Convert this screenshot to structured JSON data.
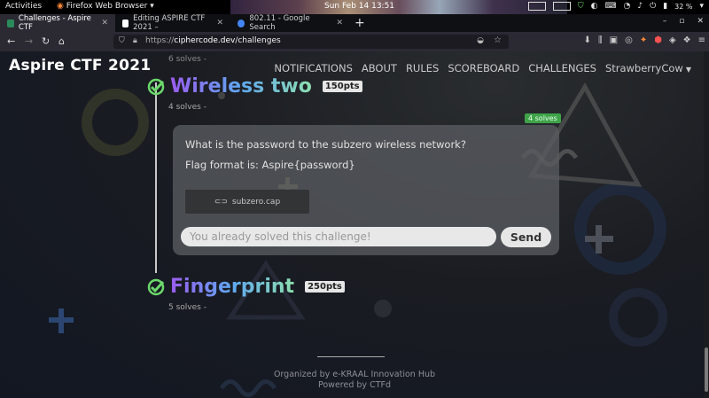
{
  "gnome": {
    "activities": "Activities",
    "app_name": "Firefox Web Browser",
    "clock": "Sun Feb 14  13:51",
    "battery": "32 %"
  },
  "tabs": [
    {
      "title": "Challenges - Aspire CTF",
      "favicon_color": "#2a8a5a"
    },
    {
      "title": "Editing ASPIRE CTF 2021 –",
      "favicon_color": "#ffffff"
    },
    {
      "title": "802.11 - Google Search",
      "favicon_color": "#4285f4"
    }
  ],
  "navbar": {
    "url_prefix": "https://",
    "url_host": "ciphercode.dev",
    "url_path": "/challenges"
  },
  "site": {
    "brand": "Aspire CTF 2021",
    "nav": [
      "NOTIFICATIONS",
      "ABOUT",
      "RULES",
      "SCOREBOARD",
      "CHALLENGES",
      "StrawberryCow"
    ],
    "prev_solves": "6 solves -"
  },
  "challenges": [
    {
      "name": "Wireless two",
      "points": "150pts",
      "solves": "4 solves -",
      "badge": "4 solves",
      "description": "What is the password to the subzero wireless network?",
      "flag_format": "Flag format is: Aspire{password}",
      "file": "subzero.cap",
      "answer_placeholder": "You already solved this challenge!",
      "submit_label": "Send"
    },
    {
      "name": "Fingerprint",
      "points": "250pts",
      "solves": "5 solves -"
    }
  ],
  "footer": {
    "organized": "Organized by e-KRAAL Innovation Hub",
    "powered": "Powered by CTFd"
  },
  "colors": {
    "accent_green": "#3fa34a",
    "check_green": "#6cd96c"
  }
}
